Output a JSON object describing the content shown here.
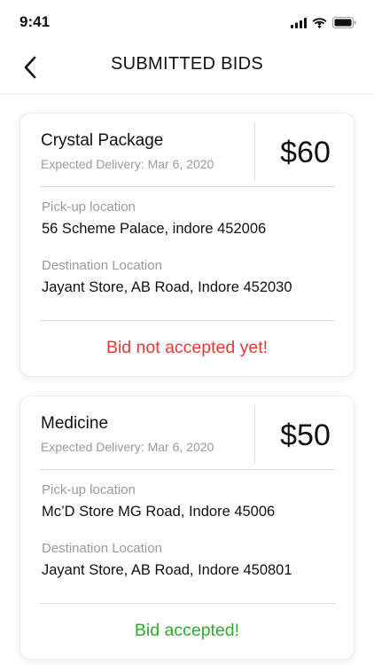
{
  "status_bar": {
    "time": "9:41",
    "icons": [
      "signal-icon",
      "wifi-icon",
      "battery-icon"
    ]
  },
  "header": {
    "title": "SUBMITTED BIDS",
    "back_icon": "chevron-left-icon"
  },
  "bids": [
    {
      "name": "Crystal Package",
      "expected_delivery": "Expected Delivery: Mar 6, 2020",
      "price": "$60",
      "pickup_label": "Pick-up location",
      "pickup_value": "56 Scheme Palace, indore 452006",
      "destination_label": "Destination Location",
      "destination_value": "Jayant Store, AB Road, Indore 452030",
      "status": "Bid not accepted yet!",
      "status_color": "#e53935"
    },
    {
      "name": "Medicine",
      "expected_delivery": "Expected Delivery: Mar 6, 2020",
      "price": "$50",
      "pickup_label": "Pick-up location",
      "pickup_value": "Mc’D Store MG Road, Indore 45006",
      "destination_label": "Destination Location",
      "destination_value": "Jayant Store, AB Road, Indore 450801",
      "status": "Bid accepted!",
      "status_color": "#2eaa2e"
    }
  ]
}
